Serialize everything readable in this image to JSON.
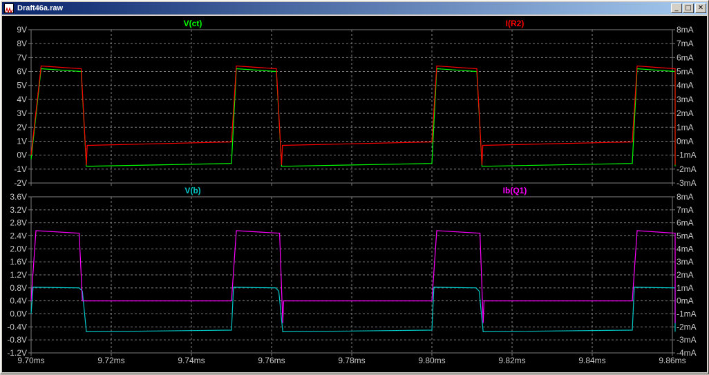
{
  "window": {
    "title": "Draft46a.raw",
    "controls": {
      "minimize": "_",
      "maximize": "□",
      "close": "✕"
    }
  },
  "colors": {
    "background": "#000000",
    "grid": "#7f7f7f",
    "axis_text": "#c8c8c8",
    "v_ct": "#00ff00",
    "i_r2": "#ff0000",
    "v_b": "#00c8c8",
    "ib_q1": "#ff00ff"
  },
  "chart_data": [
    {
      "type": "line",
      "x_ticks": [
        "9.70ms",
        "9.72ms",
        "9.74ms",
        "9.76ms",
        "9.78ms",
        "9.80ms",
        "9.82ms",
        "9.84ms",
        "9.86ms"
      ],
      "xlim_ms": [
        9.7,
        9.86
      ],
      "y_left": {
        "ticks": [
          "9V",
          "8V",
          "7V",
          "6V",
          "5V",
          "4V",
          "3V",
          "2V",
          "1V",
          "0V",
          "-1V",
          "-2V"
        ],
        "lim": [
          -2,
          9
        ]
      },
      "y_right": {
        "ticks": [
          "8mA",
          "7mA",
          "6mA",
          "5mA",
          "4mA",
          "3mA",
          "2mA",
          "1mA",
          "0mA",
          "-1mA",
          "-2mA",
          "-3mA"
        ],
        "lim": [
          -3,
          8
        ]
      },
      "grid": true,
      "series": [
        {
          "name": "V(ct)",
          "axis": "left",
          "color": "#00ff00",
          "points_ms": [
            [
              9.7,
              -0.3
            ],
            [
              9.7025,
              6.2
            ],
            [
              9.7125,
              6.0
            ],
            [
              9.7138,
              -0.8
            ],
            [
              9.75,
              -0.6
            ],
            [
              9.7512,
              6.2
            ],
            [
              9.7612,
              6.0
            ],
            [
              9.7625,
              -0.8
            ],
            [
              9.8,
              -0.6
            ],
            [
              9.8012,
              6.2
            ],
            [
              9.8112,
              6.0
            ],
            [
              9.8125,
              -0.8
            ],
            [
              9.85,
              -0.6
            ],
            [
              9.8512,
              6.2
            ],
            [
              9.8612,
              6.0
            ],
            [
              9.8625,
              -0.8
            ],
            [
              9.866,
              -0.8
            ]
          ]
        },
        {
          "name": "I(R2)",
          "axis": "right",
          "color": "#ff0000",
          "points_ms": [
            [
              9.7,
              -1.0
            ],
            [
              9.7025,
              5.4
            ],
            [
              9.7125,
              5.2
            ],
            [
              9.7138,
              -1.7
            ],
            [
              9.714,
              -0.3
            ],
            [
              9.75,
              -0.05
            ],
            [
              9.7512,
              5.4
            ],
            [
              9.7612,
              5.2
            ],
            [
              9.7625,
              -1.7
            ],
            [
              9.7627,
              -0.3
            ],
            [
              9.8,
              -0.05
            ],
            [
              9.8012,
              5.4
            ],
            [
              9.8112,
              5.2
            ],
            [
              9.8125,
              -1.7
            ],
            [
              9.8127,
              -0.3
            ],
            [
              9.85,
              -0.05
            ],
            [
              9.8512,
              5.4
            ],
            [
              9.8612,
              5.2
            ],
            [
              9.8625,
              -1.7
            ],
            [
              9.8627,
              -0.3
            ],
            [
              9.866,
              -0.3
            ]
          ]
        }
      ]
    },
    {
      "type": "line",
      "x_ticks": [
        "9.70ms",
        "9.72ms",
        "9.74ms",
        "9.76ms",
        "9.78ms",
        "9.80ms",
        "9.82ms",
        "9.84ms",
        "9.86ms"
      ],
      "xlim_ms": [
        9.7,
        9.86
      ],
      "y_left": {
        "ticks": [
          "3.6V",
          "3.2V",
          "2.8V",
          "2.4V",
          "2.0V",
          "1.6V",
          "1.2V",
          "0.8V",
          "0.4V",
          "0.0V",
          "-0.4V",
          "-0.8V",
          "-1.2V"
        ],
        "lim": [
          -1.2,
          3.6
        ]
      },
      "y_right": {
        "ticks": [
          "8mA",
          "7mA",
          "6mA",
          "5mA",
          "4mA",
          "3mA",
          "2mA",
          "1mA",
          "0mA",
          "-1mA",
          "-2mA",
          "-3mA",
          "-4mA"
        ],
        "lim": [
          -4,
          8
        ]
      },
      "grid": true,
      "series": [
        {
          "name": "V(b)",
          "axis": "left",
          "color": "#00c8c8",
          "points_ms": [
            [
              9.7,
              0.0
            ],
            [
              9.7005,
              0.82
            ],
            [
              9.712,
              0.8
            ],
            [
              9.7128,
              0.7
            ],
            [
              9.7138,
              -0.55
            ],
            [
              9.75,
              -0.5
            ],
            [
              9.7505,
              0.82
            ],
            [
              9.761,
              0.8
            ],
            [
              9.7618,
              0.7
            ],
            [
              9.7628,
              -0.55
            ],
            [
              9.8,
              -0.5
            ],
            [
              9.8005,
              0.82
            ],
            [
              9.811,
              0.8
            ],
            [
              9.8118,
              0.7
            ],
            [
              9.8128,
              -0.55
            ],
            [
              9.85,
              -0.5
            ],
            [
              9.8505,
              0.82
            ],
            [
              9.861,
              0.8
            ],
            [
              9.8618,
              0.7
            ],
            [
              9.8628,
              -0.55
            ],
            [
              9.866,
              -0.55
            ]
          ]
        },
        {
          "name": "Ib(Q1)",
          "axis": "right",
          "color": "#ff00ff",
          "points_ms": [
            [
              9.7,
              0.0
            ],
            [
              9.7012,
              5.4
            ],
            [
              9.712,
              5.2
            ],
            [
              9.7128,
              0.0
            ],
            [
              9.75,
              0.0
            ],
            [
              9.7512,
              5.4
            ],
            [
              9.762,
              5.2
            ],
            [
              9.7628,
              -1.7
            ],
            [
              9.763,
              0.0
            ],
            [
              9.8,
              0.0
            ],
            [
              9.8012,
              5.4
            ],
            [
              9.812,
              5.2
            ],
            [
              9.8128,
              -1.7
            ],
            [
              9.813,
              0.0
            ],
            [
              9.85,
              0.0
            ],
            [
              9.8512,
              5.4
            ],
            [
              9.862,
              5.2
            ],
            [
              9.8628,
              -1.7
            ],
            [
              9.863,
              0.0
            ],
            [
              9.866,
              0.0
            ]
          ]
        }
      ]
    }
  ]
}
